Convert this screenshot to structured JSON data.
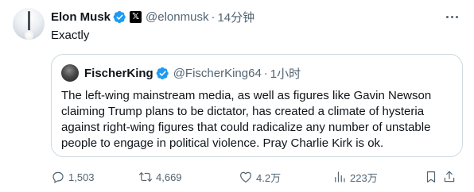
{
  "post": {
    "author_name": "Elon Musk",
    "author_handle": "@elonmusk",
    "time": "14分钟",
    "separator": "·",
    "text": "Exactly"
  },
  "quoted": {
    "author_name": "FischerKing",
    "author_handle": "@FischerKing64",
    "time": "1小时",
    "separator": "·",
    "lines": [
      "The left-wing mainstream media, as well as figures like Gavin Newson",
      "claiming Trump plans to be dictator, has created a climate of hysteria",
      "against right-wing figures that could radicalize any number of unstable",
      "people to engage in political violence. Pray Charlie Kirk is ok."
    ]
  },
  "actions": {
    "replies": "1,503",
    "reposts": "4,669",
    "likes": "4.2万",
    "views": "223万"
  },
  "icons": [
    "verified-badge-icon",
    "x-logo-icon",
    "more-icon",
    "reply-icon",
    "repost-icon",
    "like-icon",
    "views-icon",
    "bookmark-icon",
    "share-icon"
  ],
  "colors": {
    "text": "#0f1419",
    "muted": "#536471",
    "verified": "#1d9bf0",
    "border": "#cfd9de"
  }
}
